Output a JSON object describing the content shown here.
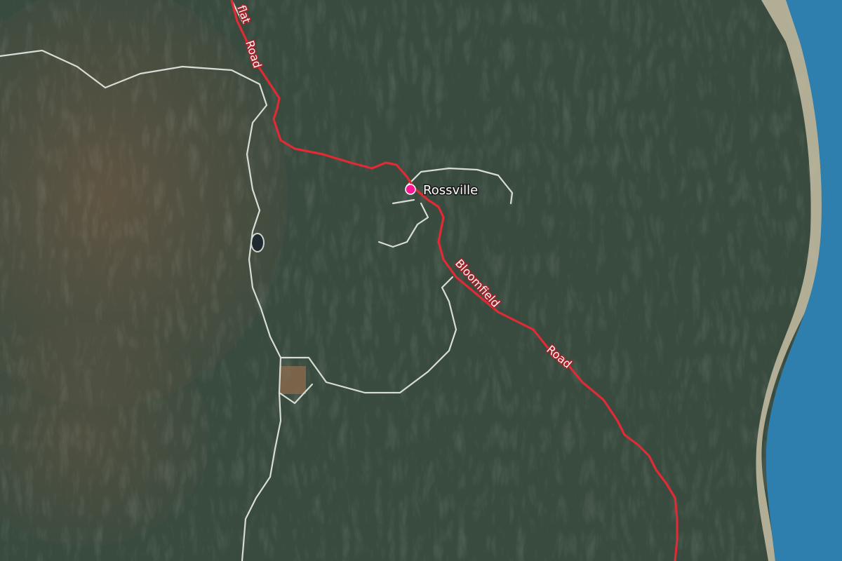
{
  "map": {
    "place": {
      "name": "Rossville",
      "marker_color": "#ff1493"
    },
    "roads": {
      "main_label_north": "Road",
      "main_label_north_partial": "flat",
      "main_label_south_1": "Bloomfield",
      "main_label_south_2": "Road",
      "main_color": "#e02a36",
      "track_color": "#d8dcd6"
    },
    "colors": {
      "sea": "#2f7fae",
      "beach": "#c9c1a8",
      "forest": "#3d4f42",
      "dry_hills": "#6b5a48"
    }
  }
}
